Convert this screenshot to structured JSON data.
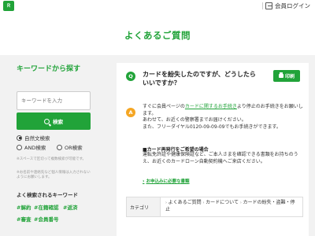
{
  "header": {
    "logo_text": "Ｒ",
    "login_label": "会員ログイン"
  },
  "page": {
    "title": "よくあるご質問"
  },
  "sidebar": {
    "heading": "キーワードから探す",
    "search_placeholder": "キーワードを入力",
    "search_button": "検索",
    "options": [
      {
        "label": "自然文検索",
        "checked": true
      },
      {
        "label": "AND検索",
        "checked": false
      },
      {
        "label": "OR検索",
        "checked": false
      }
    ],
    "note1": "※スペースで区切って複数検索が可能です。",
    "note2": "※お名前や連絡先など個人情報は入力されないようにお願いします。",
    "popular_heading": "よく検索されるキーワード",
    "tags": [
      "#解約",
      "#在籍確認",
      "#返済",
      "#審査",
      "#会員番号"
    ]
  },
  "faq": {
    "q_badge": "Q",
    "question": "カードを紛失したのですが、どうしたらいいですか？",
    "print_label": "印刷",
    "a_badge": "A",
    "answer_pre": "すぐに会員ページの",
    "answer_link": "カードに関するお手続き",
    "answer_post": "より停止のお手続きをお願いします。",
    "answer_line2": "あわせて、お近くの警察署までお届けください。",
    "answer_line3": "また、フリーダイヤル0120-09-09-09でもお手続きができます。",
    "reissue_heading": "■カード再発行をご希望の場合",
    "reissue_text": "運転免許証や健康保険証など、ご本人さまを確認できる書類をお持ちのうえ、お近くのカードローン自動契約機へご来店ください。",
    "apply_link": "お申込みに必要な書類",
    "category_label": "カテゴリ",
    "category_path": [
      "よくあるご質問",
      "カードについて",
      "カードの紛失・盗難・停止"
    ]
  },
  "colors": {
    "accent": "#21a339",
    "answer_badge": "#f5a623",
    "background": "#f2f2f2"
  }
}
